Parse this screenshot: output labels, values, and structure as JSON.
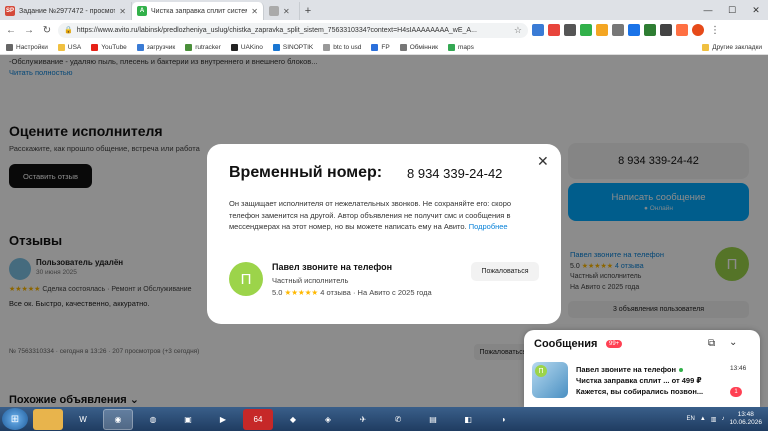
{
  "browser": {
    "tabs": [
      {
        "label": "Задание №2977472 - просмотр з",
        "favicon": "SP",
        "color": "#d44a3a",
        "active": false
      },
      {
        "label": "Чистка заправка сплит систем (7",
        "favicon": "A",
        "color": "#32b14a",
        "active": true
      },
      {
        "label": "",
        "favicon": "",
        "color": "#aaa",
        "active": false
      }
    ],
    "new_tab": "+",
    "url": "https://www.avito.ru/labinsk/predlozheniya_uslug/chistka_zapravka_split_sistem_7563310334?context=H4sIAAAAAAAA_wE_A...",
    "bookmarks": [
      "Настройки",
      "USA",
      "YouTube",
      "загрузчик",
      "rutracker",
      "UAKino",
      "SINOPTIK",
      "btc to usd",
      "FP",
      "Обмінник",
      "maps"
    ],
    "bookmarks_right": "Другие закладки"
  },
  "page": {
    "desc_line": "-Обслуживание - удаляю пыль, плесень и бактерии из внутреннего и внешнего блоков...",
    "read_more": "Читать полностью",
    "rate_title": "Оцените исполнителя",
    "rate_sub": "Расскажите, как прошло общение, встреча или работа",
    "rate_button": "Оставить отзыв",
    "reviews_title": "Отзывы",
    "review": {
      "author": "Пользователь удалён",
      "date": "30 июня 2025",
      "stars": "★★★★★",
      "tags": "Сделка состоялась · Ремонт и Обслуживание",
      "text": "Все ок. Быстро, качественно, аккуратно."
    },
    "ad_meta": "№ 7563310334 · сегодня в 13:26 · 207 просмотров (+3 сегодня)",
    "complain_label": "Пожаловаться",
    "similar_title": "Похожие объявления",
    "side": {
      "phone": "8 934 339-24-42",
      "write_label": "Написать сообщение",
      "online_label": "Онлайн",
      "seller_name": "Павел звоните на телефон",
      "seller_score": "5.0",
      "seller_stars": "★★★★★",
      "seller_reviews": "4 отзыва",
      "seller_type": "Частный исполнитель",
      "seller_since": "На Авито с 2025 года",
      "avatar_letter": "П",
      "reviews_button": "3 объявления пользователя"
    }
  },
  "modal": {
    "title": "Временный номер:",
    "number": "8 934 339-24-42",
    "text": "Он защищает исполнителя от нежелательных звонков. Не сохраняйте его: скоро телефон заменится на другой. Автор объявления не получит смс и сообщения в мессенджерах на этот номер, но вы можете написать ему на Авито.",
    "link": "Подробнее",
    "avatar_letter": "П",
    "name": "Павел звоните на телефон",
    "type": "Частный исполнитель",
    "score": "5.0",
    "stars": "★★★★★",
    "reviews": "4 отзыва",
    "since": "На Авито с 2025 года",
    "complain": "Пожаловаться"
  },
  "messages": {
    "title": "Сообщения",
    "badge": "99+",
    "avatar_letter": "П",
    "name": "Павел звоните на телефон",
    "time": "13:46",
    "item": "Чистка заправка сплит ... от 499 ₽",
    "preview": "Кажется, вы собирались позвон...",
    "unread": "1"
  },
  "taskbar": {
    "lang": "EN",
    "time": "13:48",
    "date": "10.06.2026"
  },
  "colors": {
    "accent_blue": "#00aaff",
    "link": "#0a82d8",
    "avatar_green": "#9cd44a",
    "star": "#ffb800"
  }
}
